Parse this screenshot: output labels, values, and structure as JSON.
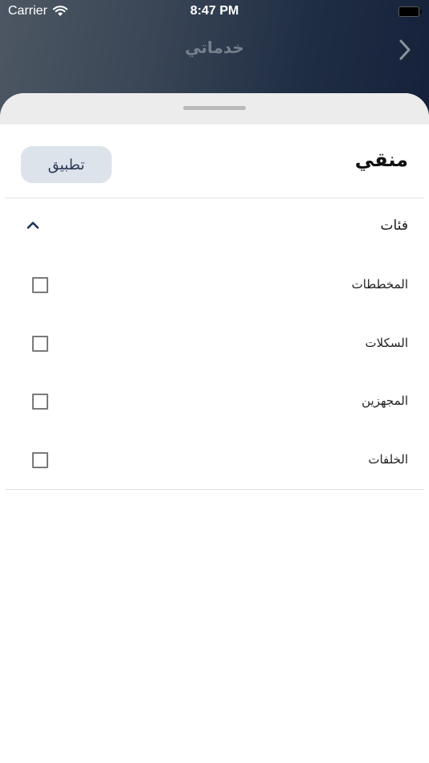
{
  "status_bar": {
    "carrier": "Carrier",
    "time": "8:47 PM"
  },
  "nav": {
    "title": "خدماتي",
    "back_icon": "chevron-right-icon"
  },
  "sheet": {
    "title": "منقي",
    "apply_label": "تطبيق",
    "section": {
      "title": "فئات",
      "expanded": true,
      "toggle_icon": "chevron-up-icon",
      "options": [
        {
          "label": "المخططات",
          "checked": false
        },
        {
          "label": "السكلات",
          "checked": false
        },
        {
          "label": "المجهزين",
          "checked": false
        },
        {
          "label": "الخلفات",
          "checked": false
        }
      ]
    }
  },
  "colors": {
    "apply_button_bg": "#dde3eb",
    "apply_button_text": "#2b3a55",
    "chevron": "#1f3358",
    "checkbox_border": "#7a7a7a"
  }
}
